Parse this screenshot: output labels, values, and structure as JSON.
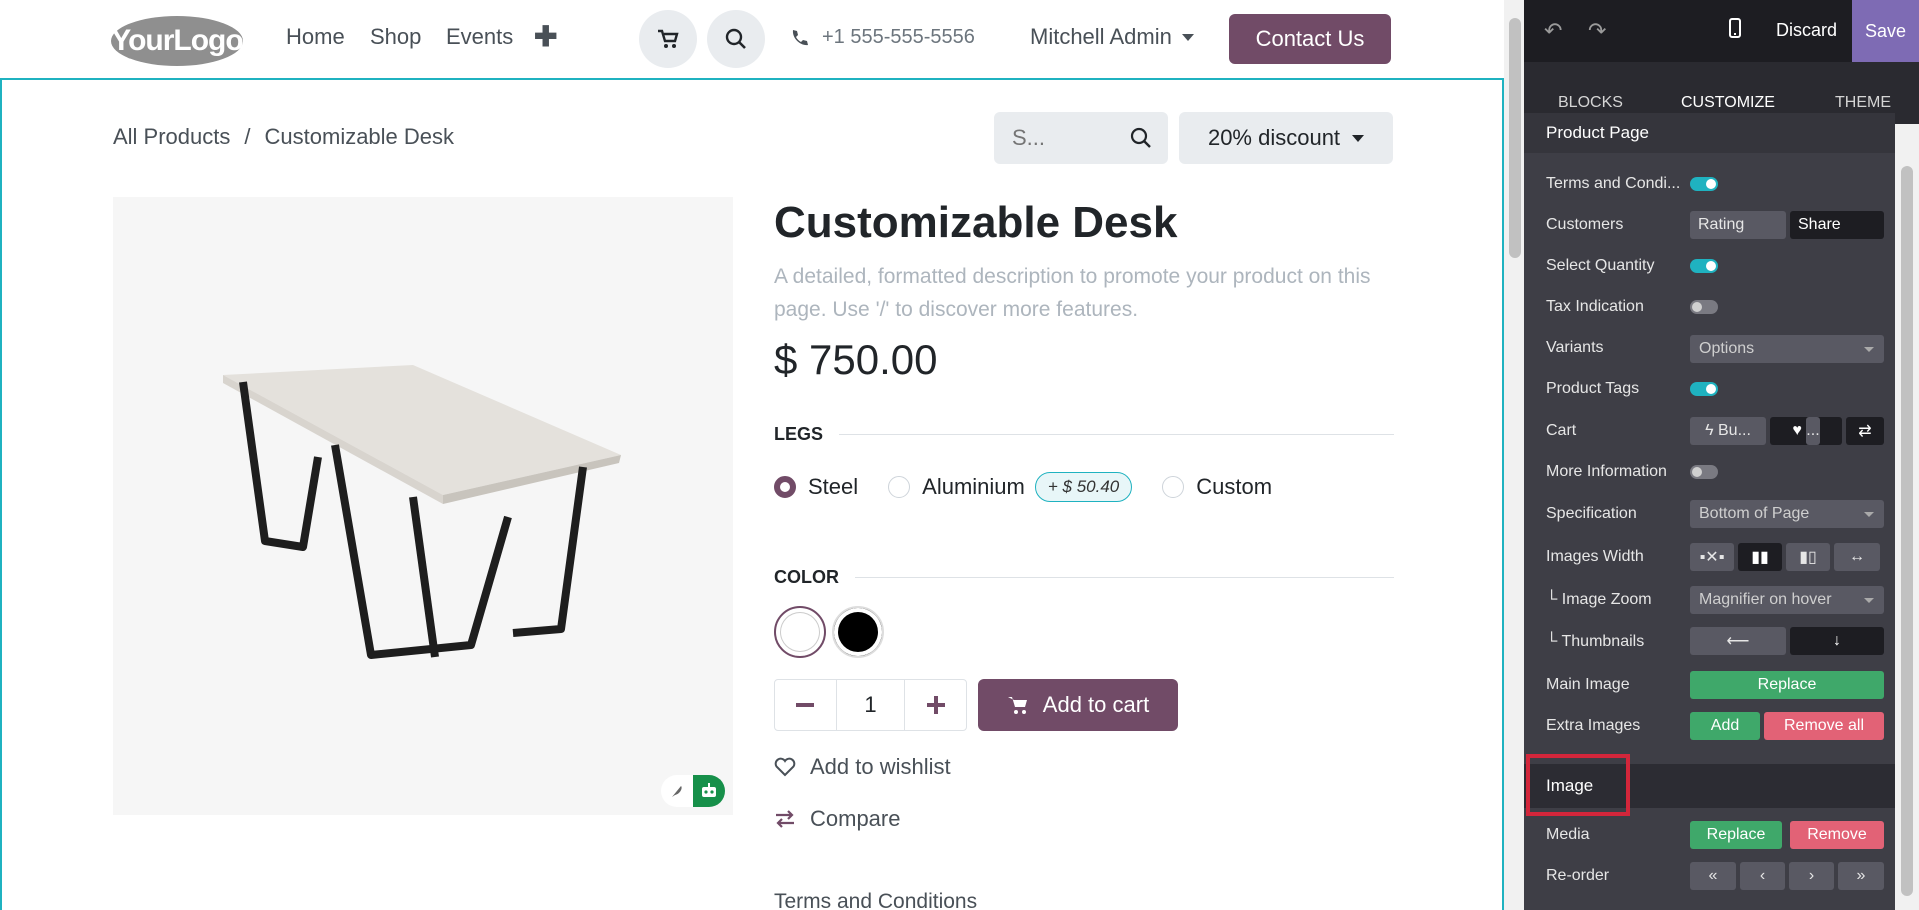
{
  "navbar": {
    "logo_text": "YourLogo",
    "links": [
      "Home",
      "Shop",
      "Events"
    ],
    "phone": "+1 555-555-5556",
    "user": "Mitchell Admin",
    "contact_label": "Contact Us"
  },
  "breadcrumb": {
    "root": "All Products",
    "sep": "/",
    "current": "Customizable Desk"
  },
  "search": {
    "placeholder": "S..."
  },
  "pricelist": {
    "label": "20% discount"
  },
  "product": {
    "title": "Customizable Desk",
    "description": "A detailed, formatted description to promote your product on this page. Use '/' to discover more features.",
    "price": "$ 750.00",
    "legs_label": "LEGS",
    "legs_options": [
      "Steel",
      "Aluminium",
      "Custom"
    ],
    "legs_selected": "Steel",
    "aluminium_extra": "+ $ 50.40",
    "color_label": "COLOR",
    "colors": [
      "#ffffff",
      "#000000"
    ],
    "quantity": "1",
    "add_to_cart": "Add to cart",
    "wishlist": "Add to wishlist",
    "compare": "Compare",
    "terms": "Terms and Conditions"
  },
  "editor": {
    "discard": "Discard",
    "save": "Save",
    "tabs": [
      "BLOCKS",
      "CUSTOMIZE",
      "THEME"
    ],
    "active_tab": "CUSTOMIZE",
    "section_product_page": "Product Page",
    "options": {
      "terms": "Terms and Condi...",
      "customers": "Customers",
      "customers_rating": "Rating",
      "customers_share": "Share",
      "select_quantity": "Select Quantity",
      "tax_indication": "Tax Indication",
      "variants": "Variants",
      "variants_value": "Options",
      "product_tags": "Product Tags",
      "cart": "Cart",
      "cart_buy": "Bu...",
      "cart_wish": "...",
      "more_information": "More Information",
      "specification": "Specification",
      "specification_value": "Bottom of Page",
      "images_width": "Images Width",
      "image_zoom": "└ Image Zoom",
      "image_zoom_value": "Magnifier on hover",
      "thumbnails": "└ Thumbnails",
      "main_image": "Main Image",
      "main_image_replace": "Replace",
      "extra_images": "Extra Images",
      "extra_add": "Add",
      "extra_remove_all": "Remove all"
    },
    "section_image": "Image",
    "image_options": {
      "media": "Media",
      "media_replace": "Replace",
      "media_remove": "Remove",
      "reorder": "Re-order"
    }
  }
}
